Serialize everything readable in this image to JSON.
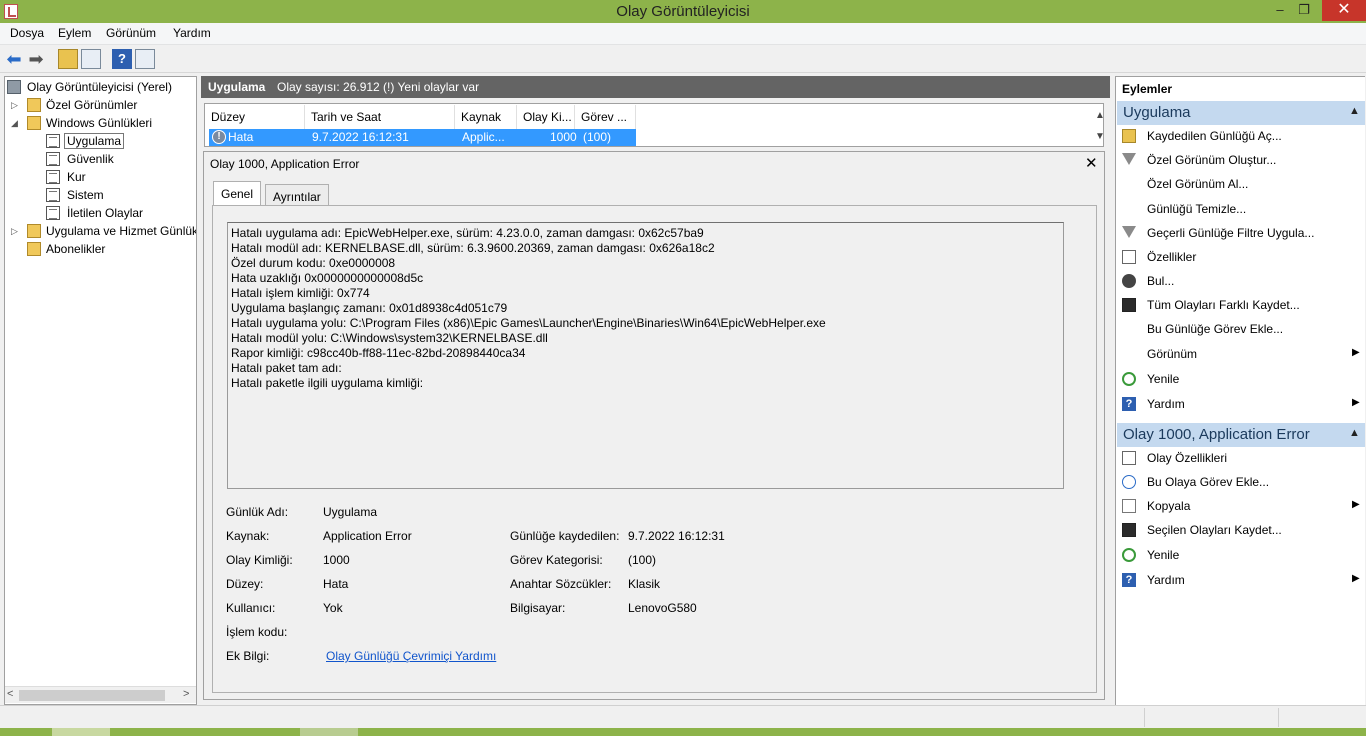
{
  "window": {
    "title": "Olay Görüntüleyicisi",
    "min": "–",
    "max": "❐",
    "close": "✕"
  },
  "menu": [
    "Dosya",
    "Eylem",
    "Görünüm",
    "Yardım"
  ],
  "toolbar": {
    "help": "?"
  },
  "tree": {
    "root": "Olay Görüntüleyicisi (Yerel)",
    "custom_views": "Özel Görünümler",
    "windows_logs": "Windows Günlükleri",
    "logs": [
      "Uygulama",
      "Güvenlik",
      "Kur",
      "Sistem",
      "İletilen Olaylar"
    ],
    "app_service_logs": "Uygulama ve Hizmet Günlük",
    "subscriptions": "Abonelikler",
    "selected": "Uygulama"
  },
  "center": {
    "header_title": "Uygulama",
    "header_count": "Olay sayısı: 26.912 (!) Yeni olaylar var",
    "columns": [
      "Düzey",
      "Tarih ve Saat",
      "Kaynak",
      "Olay Ki...",
      "Görev ..."
    ],
    "selected_row": {
      "level": "Hata",
      "date": "9.7.2022 16:12:31",
      "source": "Applic...",
      "event_id": "1000",
      "task": "(100)"
    }
  },
  "detail": {
    "title": "Olay 1000, Application Error",
    "tabs": [
      "Genel",
      "Ayrıntılar"
    ],
    "description": [
      "Hatalı uygulama adı: EpicWebHelper.exe, sürüm: 4.23.0.0, zaman damgası: 0x62c57ba9",
      "Hatalı modül adı: KERNELBASE.dll, sürüm: 6.3.9600.20369, zaman damgası: 0x626a18c2",
      "Özel durum kodu: 0xe0000008",
      "Hata uzaklığı 0x0000000000008d5c",
      "Hatalı işlem kimliği: 0x774",
      "Uygulama başlangıç zamanı: 0x01d8938c4d051c79",
      "Hatalı uygulama yolu: C:\\Program Files (x86)\\Epic Games\\Launcher\\Engine\\Binaries\\Win64\\EpicWebHelper.exe",
      "Hatalı modül yolu: C:\\Windows\\system32\\KERNELBASE.dll",
      "Rapor kimliği: c98cc40b-ff88-11ec-82bd-20898440ca34",
      "Hatalı paket tam adı:",
      "Hatalı paketle ilgili uygulama kimliği:"
    ],
    "fields": {
      "log_name_label": "Günlük Adı:",
      "log_name": "Uygulama",
      "source_label": "Kaynak:",
      "source": "Application Error",
      "logged_label": "Günlüğe kaydedilen:",
      "logged": "9.7.2022 16:12:31",
      "event_id_label": "Olay Kimliği:",
      "event_id": "1000",
      "task_cat_label": "Görev Kategorisi:",
      "task_cat": "(100)",
      "level_label": "Düzey:",
      "level": "Hata",
      "keywords_label": "Anahtar Sözcükler:",
      "keywords": "Klasik",
      "user_label": "Kullanıcı:",
      "user": "Yok",
      "computer_label": "Bilgisayar:",
      "computer": "LenovoG580",
      "opcode_label": "İşlem kodu:",
      "more_info_label": "Ek Bilgi:",
      "more_info_link": "Olay Günlüğü Çevrimiçi Yardımı"
    }
  },
  "actions": {
    "header": "Eylemler",
    "section1": "Uygulama",
    "section1_items": [
      "Kaydedilen Günlüğü Aç...",
      "Özel Görünüm Oluştur...",
      "Özel Görünüm Al...",
      "Günlüğü Temizle...",
      "Geçerli Günlüğe Filtre Uygula...",
      "Özellikler",
      "Bul...",
      "Tüm Olayları Farklı Kaydet...",
      "Bu Günlüğe Görev Ekle...",
      "Görünüm",
      "Yenile",
      "Yardım"
    ],
    "section2": "Olay 1000, Application Error",
    "section2_items": [
      "Olay Özellikleri",
      "Bu Olaya Görev Ekle...",
      "Kopyala",
      "Seçilen Olayları Kaydet...",
      "Yenile",
      "Yardım"
    ]
  },
  "icons": {
    "back": "arrow-left-icon",
    "forward": "arrow-right-icon"
  },
  "colors": {
    "titlebar": "#8db34a",
    "selection": "#3399ff",
    "section": "#c4d9ef",
    "close": "#c7352a"
  }
}
